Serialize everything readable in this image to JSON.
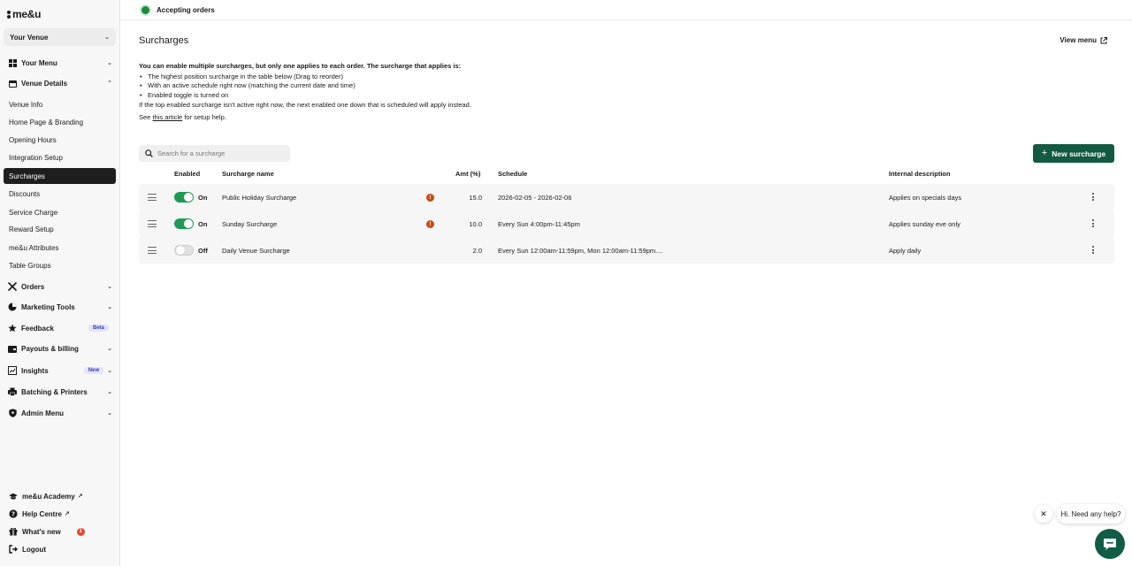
{
  "brand": {
    "logo_text": "me&u"
  },
  "venue_select": {
    "label": "Your Venue"
  },
  "sidebar": {
    "groups": [
      {
        "label": "Your Menu",
        "icon": "grid-icon"
      },
      {
        "label": "Venue Details",
        "icon": "calendar-icon"
      },
      {
        "label": "Orders",
        "icon": "cutlery-icon"
      },
      {
        "label": "Marketing Tools",
        "icon": "pie-chart-icon"
      },
      {
        "label": "Feedback",
        "icon": "star-icon",
        "badge": "Beta"
      },
      {
        "label": "Payouts & billing",
        "icon": "wallet-icon"
      },
      {
        "label": "Insights",
        "icon": "chart-icon",
        "badge": "New"
      },
      {
        "label": "Batching & Printers",
        "icon": "printer-icon"
      },
      {
        "label": "Admin Menu",
        "icon": "shield-icon"
      }
    ],
    "venue_details_items": [
      "Venue Info",
      "Home Page & Branding",
      "Opening Hours",
      "Integration Setup",
      "Surcharges",
      "Discounts",
      "Service Charge",
      "Reward Setup",
      "me&u Attributes",
      "Table Groups"
    ],
    "bottom_items": [
      {
        "label": "me&u Academy",
        "icon": "graduation-cap-icon"
      },
      {
        "label": "Help Centre",
        "icon": "help-icon"
      },
      {
        "label": "What's new",
        "icon": "gift-icon",
        "count": "1"
      },
      {
        "label": "Logout",
        "icon": "logout-icon"
      }
    ]
  },
  "topbar": {
    "status": "Accepting orders",
    "status_color": "#1f8a3b"
  },
  "page": {
    "title": "Surcharges",
    "view_menu": "View menu",
    "intro_heading": "You can enable multiple surcharges, but only one applies to each order. The surcharge that applies is:",
    "intro_bullets": [
      "The highest position surcharge in the table below (Drag to reorder)",
      "With an active schedule right now (matching the current date and time)",
      "Enabled toggle is turned on"
    ],
    "intro_fallback": "If the top enabled surcharge isn't active right now, the next enabled one down that is scheduled will apply instead.",
    "see_prefix": "See",
    "see_link": "this article",
    "see_suffix": "for setup help.",
    "search_placeholder": "Search for a surcharge",
    "new_button": "New surcharge",
    "accent_color": "#125a42"
  },
  "table": {
    "headers": {
      "enabled": "Enabled",
      "name": "Surcharge name",
      "amount": "Amt (%)",
      "schedule": "Schedule",
      "description": "Internal description"
    },
    "rows": [
      {
        "enabled": true,
        "state": "On",
        "name": "Public Holiday Surcharge",
        "warning": true,
        "amount": "15.0",
        "schedule": "2026-02-05 - 2026-02-06",
        "description": "Applies on specials days"
      },
      {
        "enabled": true,
        "state": "On",
        "name": "Sunday Surcharge",
        "warning": true,
        "amount": "10.0",
        "schedule": "Every Sun 4:00pm-11:45pm",
        "description": "Applies sunday eve only"
      },
      {
        "enabled": false,
        "state": "Off",
        "name": "Daily Venue Surcharge",
        "warning": false,
        "amount": "2.0",
        "schedule": "Every Sun 12:00am-11:59pm, Mon 12:00am-11:59pm....",
        "description": "Apply daily"
      }
    ]
  },
  "help_widget": {
    "message": "Hi. Need any help?"
  }
}
